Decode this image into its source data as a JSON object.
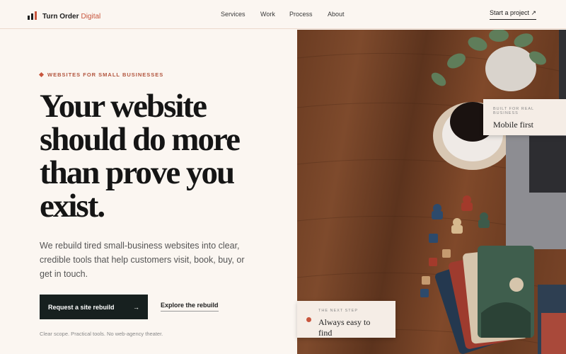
{
  "header": {
    "logo_main": "Turn Order",
    "logo_accent": "Digital",
    "nav": [
      "Services",
      "Work",
      "Process",
      "About"
    ],
    "cta": "Start a project ↗"
  },
  "hero": {
    "eyebrow": "WEBSITES FOR SMALL BUSINESSES",
    "headline": [
      "Your website",
      "should do more",
      "than prove you",
      "exist."
    ],
    "lede": "We rebuild tired small-business websites into clear, credible tools that help customers visit, book, buy, or get in touch.",
    "primary_button": "Request a site rebuild",
    "primary_arrow": "→",
    "secondary_button": "Explore the rebuild",
    "footnote": "Clear scope. Practical tools. No web-agency theater."
  },
  "image_cards": {
    "top_small": "BUILT FOR REAL BUSINESS",
    "top_big": "Mobile first",
    "bottom_small": "THE NEXT STEP",
    "bottom_big": "Always easy to find"
  },
  "colors": {
    "accent": "#c8553d",
    "dark": "#17201f",
    "background": "#fbf6f1"
  }
}
